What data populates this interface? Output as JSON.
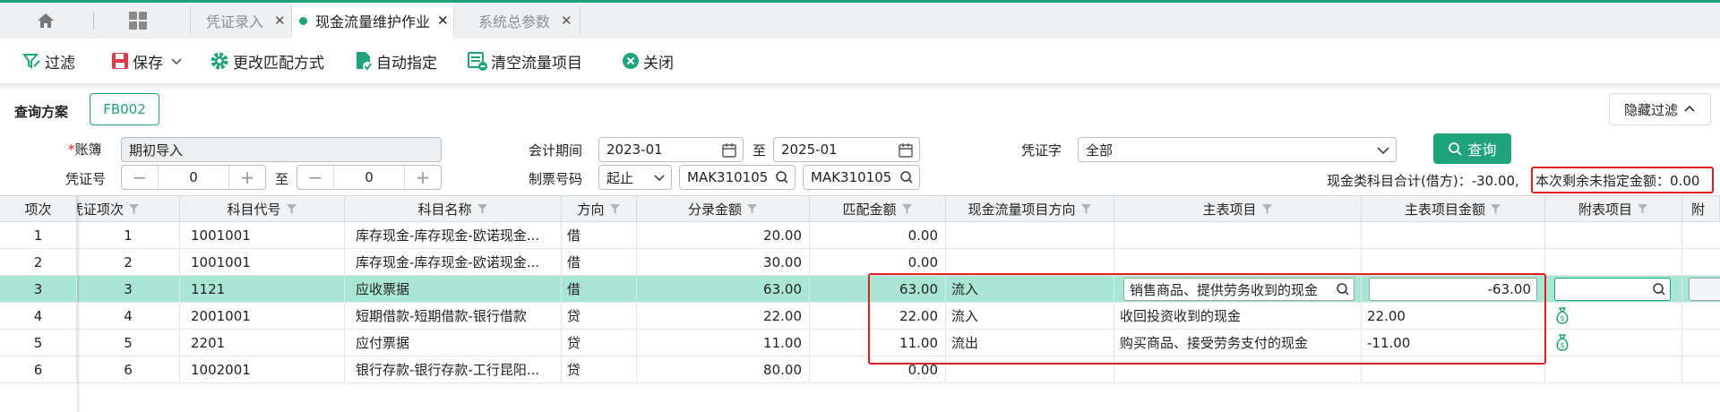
{
  "tabs": [
    {
      "label": "凭证录入",
      "active": false
    },
    {
      "label": "现金流量维护作业",
      "active": true
    },
    {
      "label": "系统总参数",
      "active": false
    }
  ],
  "toolbar": {
    "filter": "过滤",
    "save": "保存",
    "change_match": "更改匹配方式",
    "auto_assign": "自动指定",
    "clear_items": "清空流量项目",
    "close": "关闭"
  },
  "query": {
    "scheme_label": "查询方案",
    "scheme_value": "FB002",
    "hide_filter": "隐藏过滤",
    "book_label": "账簿",
    "book_value": "期初导入",
    "period_label": "会计期间",
    "period_from": "2023-01",
    "to_label": "至",
    "period_to": "2025-01",
    "voucher_word_label": "凭证字",
    "voucher_word_value": "全部",
    "query_button": "查询",
    "voucher_no_label": "凭证号",
    "voucher_no_from": "0",
    "voucher_no_to": "0",
    "ticket_label": "制票号码",
    "ticket_mode": "起止",
    "ticket_from": "MAK310105",
    "ticket_to": "MAK310105",
    "summary_total": "现金类科目合计(借方)：-30.00,",
    "summary_remaining": "本次剩余未指定金额：0.00"
  },
  "colors": {
    "accent": "#1fa37a",
    "selected_row": "#a9e6d3",
    "highlight": "#e02020"
  },
  "grid": {
    "columns": [
      "项次",
      "凭证项次",
      "科目代号",
      "科目名称",
      "方向",
      "分录金额",
      "匹配金额",
      "现金流量项目方向",
      "主表项目",
      "主表项目金额",
      "附表项目",
      "附"
    ],
    "rows": [
      {
        "idx": "1",
        "seq": "1",
        "code": "1001001",
        "name": "库存现金-库存现金-欧诺现金...",
        "dir": "借",
        "amount": "20.00",
        "match": "0.00",
        "flow_dir": "",
        "main_item": "",
        "main_amount": "",
        "selected": false
      },
      {
        "idx": "2",
        "seq": "2",
        "code": "1001001",
        "name": "库存现金-库存现金-欧诺现金...",
        "dir": "借",
        "amount": "30.00",
        "match": "0.00",
        "flow_dir": "",
        "main_item": "",
        "main_amount": "",
        "selected": false
      },
      {
        "idx": "3",
        "seq": "3",
        "code": "1121",
        "name": "应收票据",
        "dir": "借",
        "amount": "63.00",
        "match": "63.00",
        "flow_dir": "流入",
        "main_item": "销售商品、提供劳务收到的现金",
        "main_amount": "-63.00",
        "selected": true
      },
      {
        "idx": "4",
        "seq": "4",
        "code": "2001001",
        "name": "短期借款-短期借款-银行借款",
        "dir": "贷",
        "amount": "22.00",
        "match": "22.00",
        "flow_dir": "流入",
        "main_item": "收回投资收到的现金",
        "main_amount": "22.00",
        "selected": false
      },
      {
        "idx": "5",
        "seq": "5",
        "code": "2201",
        "name": "应付票据",
        "dir": "贷",
        "amount": "11.00",
        "match": "11.00",
        "flow_dir": "流出",
        "main_item": "购买商品、接受劳务支付的现金",
        "main_amount": "-11.00",
        "selected": false
      },
      {
        "idx": "6",
        "seq": "6",
        "code": "1002001",
        "name": "银行存款-银行存款-工行昆阳...",
        "dir": "贷",
        "amount": "80.00",
        "match": "0.00",
        "flow_dir": "",
        "main_item": "",
        "main_amount": "",
        "selected": false
      }
    ]
  }
}
